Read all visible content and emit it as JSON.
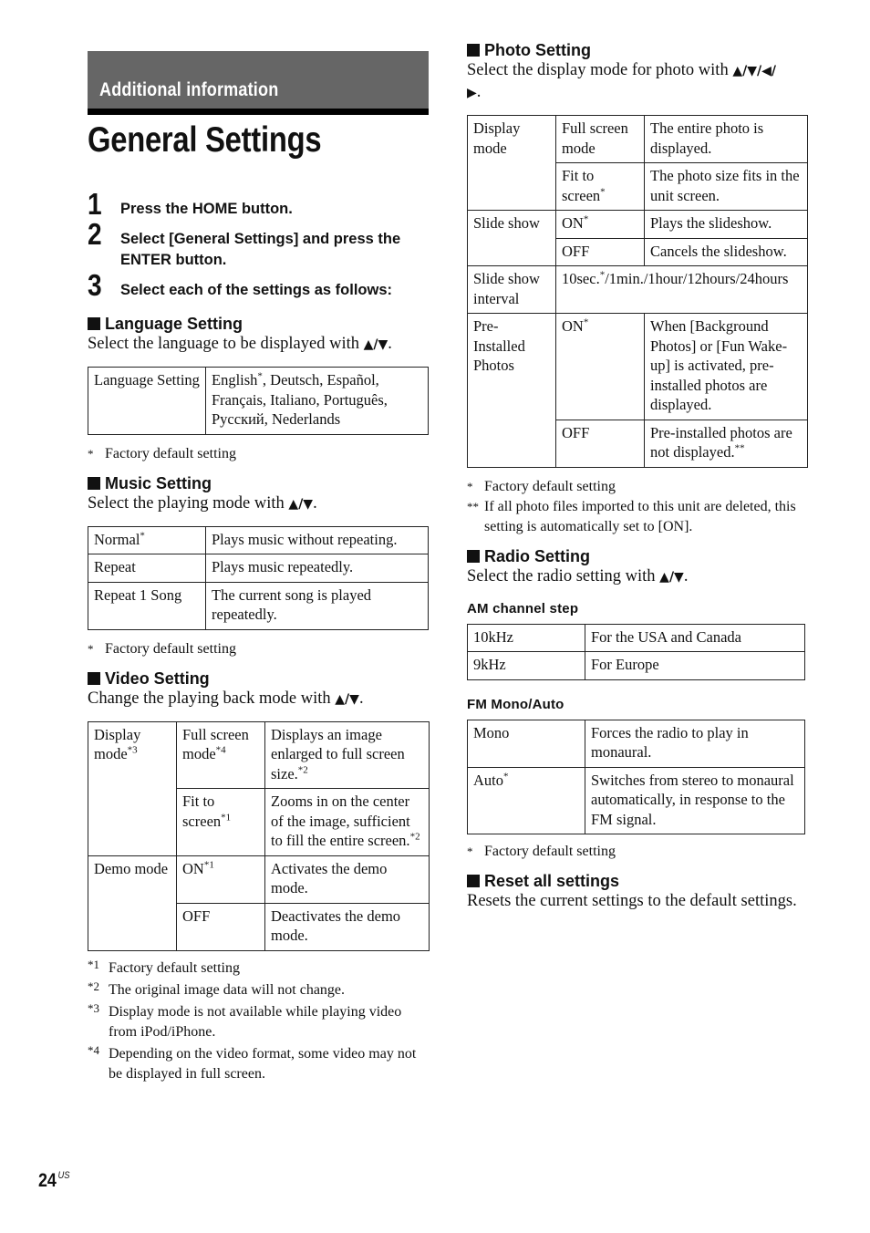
{
  "header": {
    "section_banner": "Additional information",
    "page_title": "General Settings"
  },
  "steps": [
    {
      "num": "1",
      "text": "Press the HOME button."
    },
    {
      "num": "2",
      "text": "Select [General Settings] and press the ENTER button."
    },
    {
      "num": "3",
      "text": "Select each of the settings as follows:"
    }
  ],
  "arrows": {
    "up_down": "▲/▼",
    "all_dirs": "▲/▼/◀/",
    "right": "▶"
  },
  "language": {
    "title": "Language Setting",
    "desc": "Select the language to be displayed with",
    "row_label": "Language Setting",
    "value_first": "English",
    "value_first_mark": "*",
    "value_rest": ", Deutsch, Español, Français, Italiano, Português, Русский, Nederlands",
    "note_mark": "*",
    "note": "Factory default setting"
  },
  "music": {
    "title": "Music Setting",
    "desc": "Select the playing mode with",
    "rows": [
      {
        "option": "Normal",
        "mark": "*",
        "desc": "Plays music without repeating."
      },
      {
        "option": "Repeat",
        "mark": "",
        "desc": "Plays music repeatedly."
      },
      {
        "option": "Repeat 1 Song",
        "mark": "",
        "desc": "The current song is played repeatedly."
      }
    ],
    "note_mark": "*",
    "note": "Factory default setting"
  },
  "video": {
    "title": "Video Setting",
    "desc": "Change the playing back mode with",
    "display_mode": {
      "label": "Display mode",
      "mark": "*3"
    },
    "full_screen": {
      "label": "Full screen mode",
      "mark": "*4",
      "desc": "Displays an image enlarged to full screen size.",
      "desc_mark": "*2"
    },
    "fit_screen": {
      "label": "Fit to screen",
      "mark": "*1",
      "desc": "Zooms in on the center of the image, sufficient to fill the entire screen.",
      "desc_mark": "*2"
    },
    "demo_mode": {
      "label": "Demo mode"
    },
    "demo_on": {
      "label": "ON",
      "mark": "*1",
      "desc": "Activates the demo mode."
    },
    "demo_off": {
      "label": "OFF",
      "desc": "Deactivates the demo mode."
    },
    "notes": [
      {
        "mark": "*1",
        "text": "Factory default setting"
      },
      {
        "mark": "*2",
        "text": "The original image data will not change."
      },
      {
        "mark": "*3",
        "text": "Display mode is not available while playing video from iPod/iPhone."
      },
      {
        "mark": "*4",
        "text": "Depending on the video format, some video may not be displayed in full screen."
      }
    ]
  },
  "photo": {
    "title": "Photo Setting",
    "desc": "Select the display mode for photo with",
    "display_mode": {
      "label": "Display mode"
    },
    "full_screen": {
      "label": "Full screen mode",
      "desc": "The entire photo is displayed."
    },
    "fit_screen": {
      "label": "Fit to screen",
      "mark": "*",
      "desc": "The photo size fits in the unit screen."
    },
    "slide_show": {
      "label": "Slide show"
    },
    "slide_on": {
      "label": "ON",
      "mark": "*",
      "desc": "Plays the slideshow."
    },
    "slide_off": {
      "label": "OFF",
      "desc": "Cancels the slideshow."
    },
    "interval": {
      "label": "Slide show interval",
      "first": "10sec.",
      "mark": "*",
      "rest": "/1min./1hour/12hours/24hours"
    },
    "preinstalled": {
      "label": "Pre-Installed Photos"
    },
    "pre_on": {
      "label": "ON",
      "mark": "*",
      "desc": "When [Background Photos] or [Fun Wake-up] is activated, pre-installed photos are displayed."
    },
    "pre_off": {
      "label": "OFF",
      "desc": "Pre-installed photos are not displayed.",
      "desc_mark": "**"
    },
    "notes": [
      {
        "mark": "*",
        "text": "Factory default setting"
      },
      {
        "mark": "**",
        "text": "If all photo files imported to this unit are deleted, this setting is automatically set to [ON]."
      }
    ]
  },
  "radio": {
    "title": "Radio Setting",
    "desc": "Select the radio setting with",
    "am": {
      "title": "AM channel step",
      "rows": [
        {
          "option": "10kHz",
          "desc": "For the USA and Canada"
        },
        {
          "option": "9kHz",
          "desc": "For Europe"
        }
      ]
    },
    "fm": {
      "title": "FM Mono/Auto",
      "rows": [
        {
          "option": "Mono",
          "mark": "",
          "desc": "Forces the radio to play in monaural."
        },
        {
          "option": "Auto",
          "mark": "*",
          "desc": "Switches from stereo to monaural automatically, in response to the FM signal."
        }
      ]
    },
    "note_mark": "*",
    "note": "Factory default setting"
  },
  "reset": {
    "title": "Reset all settings",
    "desc": "Resets the current settings to the default settings."
  },
  "footer": {
    "page_number": "24",
    "region": "US"
  }
}
